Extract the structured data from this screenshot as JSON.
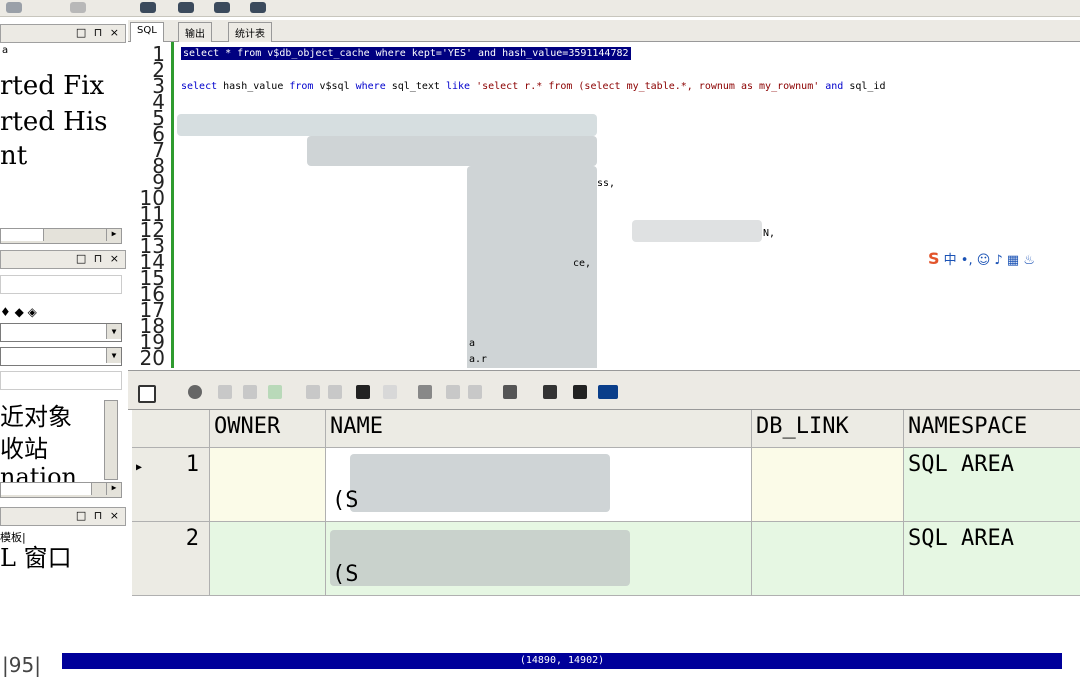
{
  "colors": {
    "selection": "#000080",
    "gutter_green": "#2f9b2f",
    "progress": "#00009a",
    "row_green": "#e6f7e3",
    "row_yellow": "#fbfbe8"
  },
  "left_panel": {
    "pane1_lines": [
      "rted Fix",
      "rted His",
      "nt"
    ],
    "pane3_lines": [
      "近对象",
      "收站",
      "nation"
    ],
    "pane4_tab": "模板|",
    "pane4_line": "L 窗口"
  },
  "editor": {
    "tabs": [
      "SQL",
      "输出",
      "统计表"
    ],
    "line_numbers": [
      "1",
      "2",
      "3",
      "4",
      "5",
      "6",
      "7",
      "8",
      "9",
      "10",
      "11",
      "12",
      "13",
      "14",
      "15",
      "16",
      "17",
      "18",
      "19",
      "20"
    ],
    "line1": "select * from v$db_object_cache where kept='YES' and  hash_value=3591144782",
    "line3_keyword1": "select",
    "line3_a": " hash_value ",
    "line3_keyword2": "from",
    "line3_b": " v$sql ",
    "line3_keyword3": "where",
    "line3_c": " sql_text ",
    "line3_keyword4": "like",
    "line3_str": " 'select r.* from (select my_table.*, rownum as my_rownum' ",
    "line3_keyword5": "and",
    "line3_d": " sql_id",
    "frag_ss": "ss,",
    "frag_n": "N,",
    "frag_ce": "ce,",
    "frag_a": "a",
    "frag_ar": "a.r"
  },
  "grid": {
    "columns": [
      "OWNER",
      "NAME",
      "DB_LINK",
      "NAMESPACE"
    ],
    "rows": [
      {
        "num": "1",
        "owner": "",
        "name_line2": "(S",
        "db_link": "",
        "namespace": "SQL AREA"
      },
      {
        "num": "2",
        "owner": "",
        "name_line2": "(S",
        "db_link": "",
        "namespace": "SQL AREA"
      }
    ]
  },
  "status": {
    "left_text": "|95|",
    "progress_text": "(14890, 14902)"
  }
}
